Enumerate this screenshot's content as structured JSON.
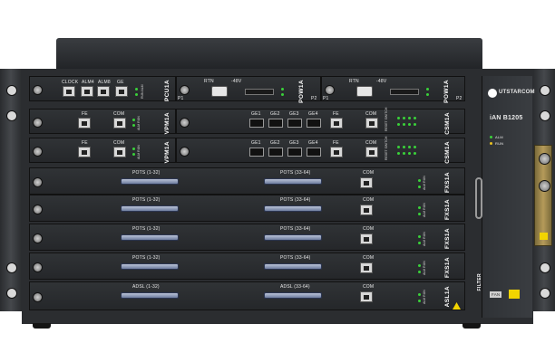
{
  "brand": {
    "logo_text": "UTSTARCOM",
    "model": "iAN B1205"
  },
  "side_panel": {
    "leds": [
      "ALM",
      "RUN"
    ],
    "filter_label": "FILTER",
    "fan_label": "FAN"
  },
  "slots": {
    "pcu": {
      "name": "PCU1A",
      "ports": [
        "CLOCK",
        "ALM4",
        "ALM8",
        "GE"
      ],
      "leds": "RUN ALM"
    },
    "pow_left": {
      "name": "POW1A",
      "rtn": "RTN",
      "volt": "-48V",
      "p1": "P1",
      "p2": "P2"
    },
    "pow_right": {
      "name": "POW1A",
      "rtn": "RTN",
      "volt": "-48V",
      "p1": "P1",
      "p2": "P2"
    },
    "vpm1": {
      "name": "VPM1A",
      "fe": "FE",
      "com": "COM",
      "leds": "ALM RUN"
    },
    "vpm2": {
      "name": "VPM1A",
      "fe": "FE",
      "com": "COM",
      "leds": "ALM RUN"
    },
    "csm1": {
      "name": "CSM1A",
      "ge": [
        "GE1",
        "GE2",
        "GE3",
        "GE4"
      ],
      "fe": "FE",
      "com": "COM",
      "leds": "RESET SWITCH"
    },
    "csm2": {
      "name": "CSM1A",
      "ge": [
        "GE1",
        "GE2",
        "GE3",
        "GE4"
      ],
      "fe": "FE",
      "com": "COM",
      "leds": "RESET SWITCH"
    },
    "lines": [
      {
        "name": "FXS1A",
        "left": "POTS  (1-32)",
        "right": "POTS  (33-64)",
        "com": "COM",
        "leds": "ALM RUN"
      },
      {
        "name": "FXS1A",
        "left": "POTS  (1-32)",
        "right": "POTS  (33-64)",
        "com": "COM",
        "leds": "ALM RUN"
      },
      {
        "name": "FXS1A",
        "left": "POTS  (1-32)",
        "right": "POTS  (33-64)",
        "com": "COM",
        "leds": "ALM RUN"
      },
      {
        "name": "FXS1A",
        "left": "POTS  (1-32)",
        "right": "POTS  (33-64)",
        "com": "COM",
        "leds": "ALM RUN"
      },
      {
        "name": "ASL1A",
        "left": "ADSL  (1-32)",
        "right": "ADSL  (33-64)",
        "com": "COM",
        "leds": "ALM RUN"
      }
    ]
  }
}
